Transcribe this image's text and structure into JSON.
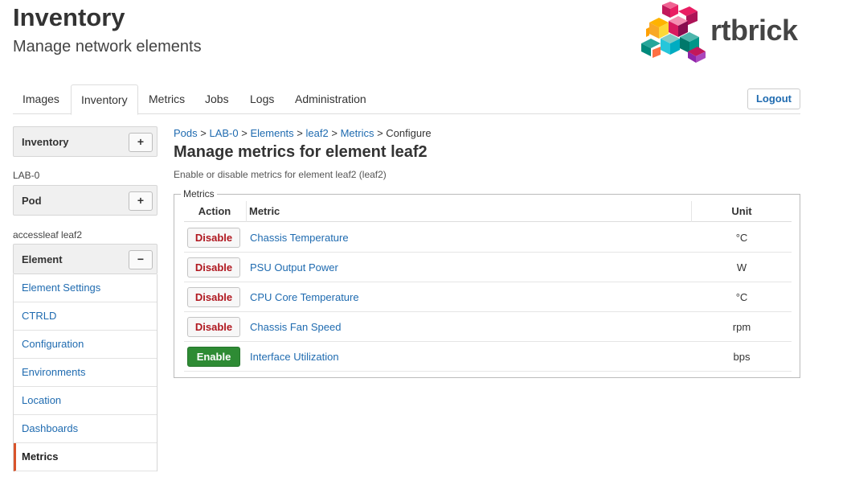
{
  "header": {
    "title": "Inventory",
    "subtitle": "Manage network elements",
    "logo_text": "rtbrick"
  },
  "tabs": [
    {
      "label": "Images"
    },
    {
      "label": "Inventory"
    },
    {
      "label": "Metrics"
    },
    {
      "label": "Jobs"
    },
    {
      "label": "Logs"
    },
    {
      "label": "Administration"
    }
  ],
  "active_tab": "Inventory",
  "logout_label": "Logout",
  "sidebar": {
    "inventory_panel": {
      "title": "Inventory",
      "button": "+"
    },
    "pod_label": "LAB-0",
    "pod_panel": {
      "title": "Pod",
      "button": "+"
    },
    "element_label": "accessleaf leaf2",
    "element_panel": {
      "title": "Element",
      "button": "−"
    },
    "items": [
      {
        "label": "Element Settings"
      },
      {
        "label": "CTRLD"
      },
      {
        "label": "Configuration"
      },
      {
        "label": "Environments"
      },
      {
        "label": "Location"
      },
      {
        "label": "Dashboards"
      },
      {
        "label": "Metrics"
      }
    ],
    "active_item": "Metrics"
  },
  "breadcrumb": {
    "items": [
      "Pods",
      "LAB-0",
      "Elements",
      "leaf2",
      "Metrics"
    ],
    "separator": ">",
    "current": "Configure"
  },
  "page": {
    "title": "Manage metrics for element leaf2",
    "description": "Enable or disable metrics for element leaf2 (leaf2)"
  },
  "metrics": {
    "legend": "Metrics",
    "columns": {
      "action": "Action",
      "metric": "Metric",
      "unit": "Unit"
    },
    "rows": [
      {
        "action": "Disable",
        "metric": "Chassis Temperature",
        "unit": "°C"
      },
      {
        "action": "Disable",
        "metric": "PSU Output Power",
        "unit": "W"
      },
      {
        "action": "Disable",
        "metric": "CPU Core Temperature",
        "unit": "°C"
      },
      {
        "action": "Disable",
        "metric": "Chassis Fan Speed",
        "unit": "rpm"
      },
      {
        "action": "Enable",
        "metric": "Interface Utilization",
        "unit": "bps"
      }
    ]
  },
  "colors": {
    "link": "#1f6bb0",
    "disable_text": "#b0171f",
    "enable_bg": "#2e8b34",
    "active_indicator": "#d9542b"
  }
}
